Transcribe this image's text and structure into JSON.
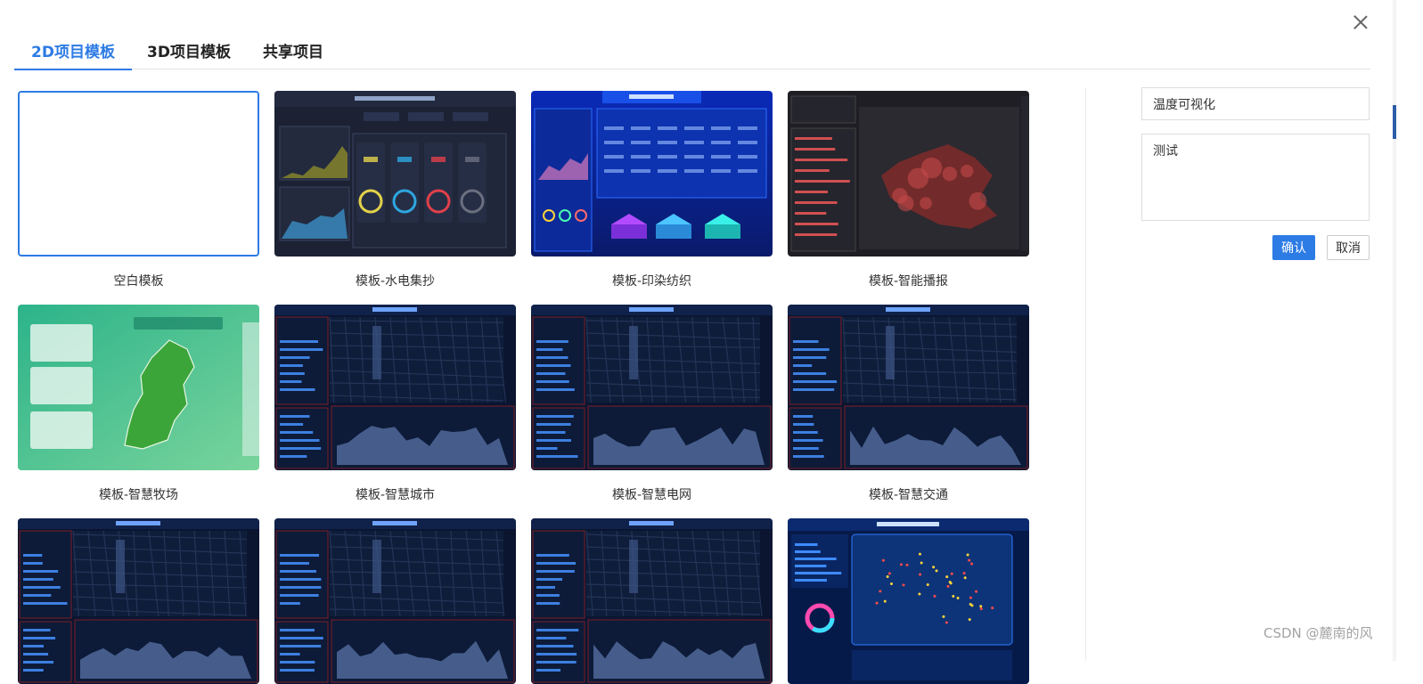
{
  "tabs": [
    {
      "label": "2D项目模板",
      "active": true
    },
    {
      "label": "3D项目模板",
      "active": false
    },
    {
      "label": "共享项目",
      "active": false
    }
  ],
  "templates": [
    {
      "label": "空白模板",
      "kind": "blank"
    },
    {
      "label": "模板-水电集抄",
      "kind": "dash"
    },
    {
      "label": "模板-印染纺织",
      "kind": "textile"
    },
    {
      "label": "模板-智能播报",
      "kind": "broadcast"
    },
    {
      "label": "模板-智慧牧场",
      "kind": "pasture"
    },
    {
      "label": "模板-智慧城市",
      "kind": "city"
    },
    {
      "label": "模板-智慧电网",
      "kind": "city"
    },
    {
      "label": "模板-智慧交通",
      "kind": "city"
    },
    {
      "label": "",
      "kind": "city"
    },
    {
      "label": "",
      "kind": "city"
    },
    {
      "label": "",
      "kind": "city"
    },
    {
      "label": "",
      "kind": "epidemic"
    }
  ],
  "form": {
    "name_value": "温度可视化",
    "desc_value": "测试",
    "confirm_label": "确认",
    "cancel_label": "取消"
  },
  "watermark": "CSDN @麓南的风",
  "colors": {
    "accent": "#2d7be5",
    "dark_navy": "#0b1530",
    "map_teal": "#1fa37a"
  }
}
